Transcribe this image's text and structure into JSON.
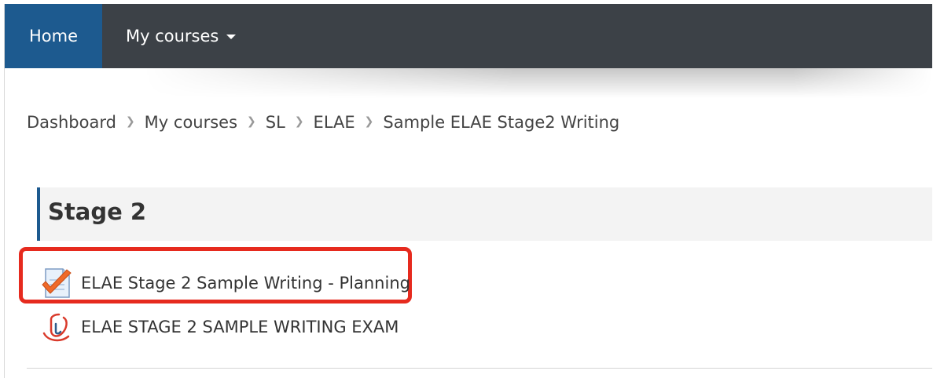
{
  "nav": {
    "home_label": "Home",
    "courses_label": "My courses"
  },
  "breadcrumb": [
    "Dashboard",
    "My courses",
    "SL",
    "ELAE",
    "Sample ELAE Stage2 Writing"
  ],
  "section": {
    "title": "Stage 2",
    "activities": [
      {
        "label": "ELAE Stage 2 Sample Writing - Planning",
        "icon": "assignment-icon",
        "highlighted": true
      },
      {
        "label": "ELAE STAGE 2 SAMPLE WRITING EXAM",
        "icon": "turnitin-icon",
        "highlighted": false
      }
    ]
  },
  "colors": {
    "navbar": "#3c4147",
    "home_active": "#1d5a8f",
    "highlight_border": "#e62a1e",
    "section_accent": "#1d5a8f"
  }
}
